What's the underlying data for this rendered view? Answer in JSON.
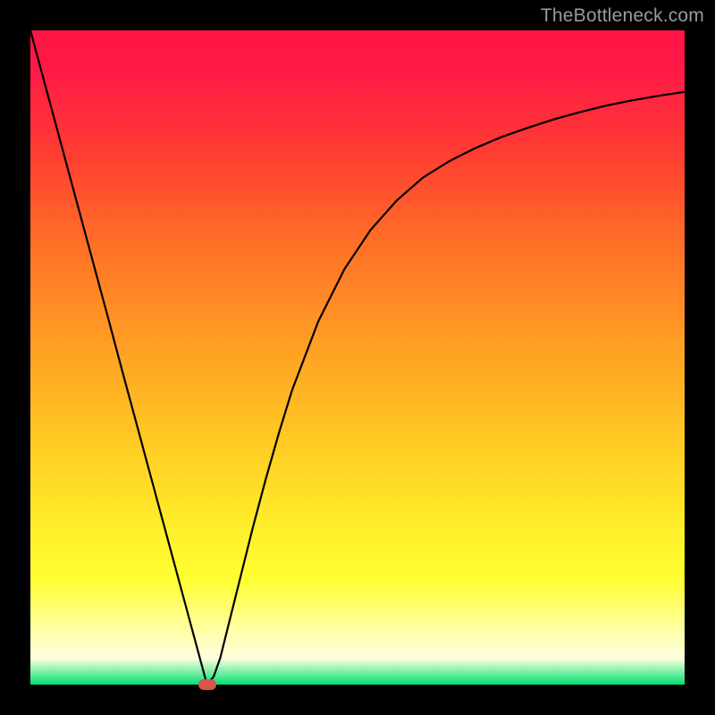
{
  "watermark": {
    "text": "TheBottleneck.com"
  },
  "colors": {
    "frame": "#000000",
    "curve": "#000000",
    "marker": "#d9544d",
    "gradient_top": "#ff1444",
    "gradient_bottom": "#00e070"
  },
  "chart_data": {
    "type": "line",
    "title": "",
    "xlabel": "",
    "ylabel": "",
    "xlim": [
      0,
      100
    ],
    "ylim": [
      0,
      100
    ],
    "grid": false,
    "x": [
      0,
      2,
      4,
      6,
      8,
      10,
      12,
      14,
      16,
      18,
      20,
      22,
      24,
      26,
      27,
      28,
      29,
      30,
      32,
      34,
      36,
      38,
      40,
      44,
      48,
      52,
      56,
      60,
      64,
      68,
      72,
      76,
      80,
      84,
      88,
      92,
      96,
      100
    ],
    "values": [
      100,
      92.6,
      85.2,
      77.8,
      70.4,
      63.0,
      55.6,
      48.1,
      40.7,
      33.3,
      25.9,
      18.5,
      11.1,
      3.7,
      0.0,
      1.2,
      4.0,
      8.0,
      16.0,
      24.0,
      31.5,
      38.5,
      45.0,
      55.5,
      63.5,
      69.5,
      74.0,
      77.5,
      80.0,
      82.0,
      83.7,
      85.1,
      86.4,
      87.5,
      88.5,
      89.3,
      90.0,
      90.6
    ],
    "marker": {
      "x": 27,
      "y": 0
    },
    "annotations": []
  }
}
